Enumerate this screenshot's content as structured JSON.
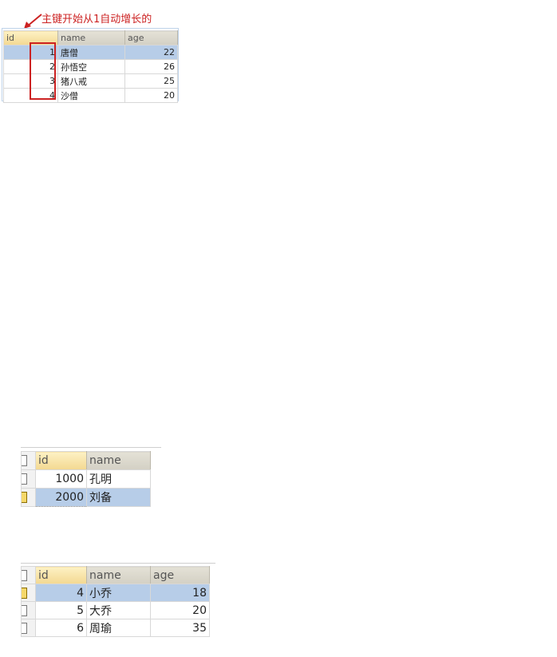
{
  "annotation": {
    "text": "主键开始从1自动增长的",
    "color": "#cc2222"
  },
  "table1": {
    "columns": [
      "id",
      "name",
      "age"
    ],
    "rows": [
      {
        "id": "1",
        "name": "唐僧",
        "age": "22"
      },
      {
        "id": "2",
        "name": "孙悟空",
        "age": "26"
      },
      {
        "id": "3",
        "name": "猪八戒",
        "age": "25"
      },
      {
        "id": "4",
        "name": "沙僧",
        "age": "20"
      }
    ]
  },
  "table2": {
    "columns": [
      "id",
      "name"
    ],
    "rows": [
      {
        "id": "1000",
        "name": "孔明"
      },
      {
        "id": "2000",
        "name": "刘备"
      }
    ]
  },
  "table3": {
    "columns": [
      "id",
      "name",
      "age"
    ],
    "rows": [
      {
        "id": "4",
        "name": "小乔",
        "age": "18"
      },
      {
        "id": "5",
        "name": "大乔",
        "age": "20"
      },
      {
        "id": "6",
        "name": "周瑜",
        "age": "35"
      }
    ]
  },
  "colors": {
    "selection": "#b7cde8",
    "header": "#d3d0c4",
    "header_highlight": "#f3d891",
    "annotation_box": "#cc2222"
  }
}
